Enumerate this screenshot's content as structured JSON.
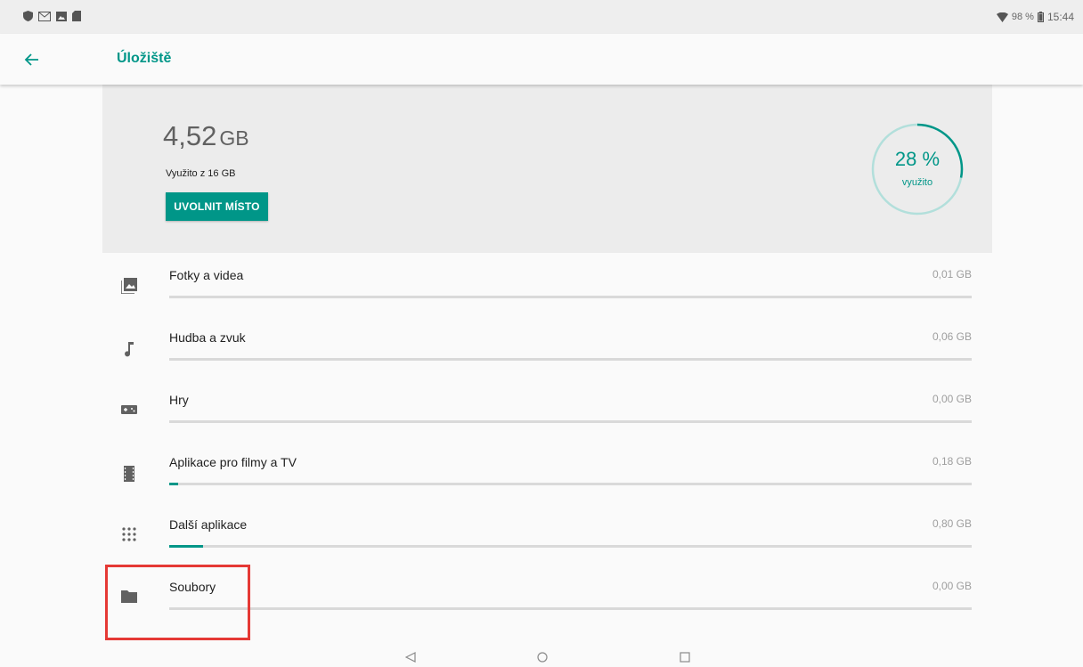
{
  "status_bar": {
    "left_icons": [
      "shield-icon",
      "gmail-icon",
      "photo-icon",
      "sd-card-icon"
    ],
    "battery_percent": "98 %",
    "time": "15:44"
  },
  "app_bar": {
    "back_icon": "arrow-back-icon",
    "title": "Úložiště"
  },
  "summary": {
    "used_value": "4,52",
    "used_unit": "GB",
    "used_of": "Využito z 16 GB",
    "free_button": "UVOLNIT MÍSTO",
    "percent_text": "28 %",
    "percent_label": "využito",
    "percent_value": 0.28
  },
  "categories": [
    {
      "label": "Fotky a videa",
      "size": "0,01 GB",
      "icon": "photo-library-icon",
      "fraction": 0.0
    },
    {
      "label": "Hudba a zvuk",
      "size": "0,06 GB",
      "icon": "music-note-icon",
      "fraction": 0.0
    },
    {
      "label": "Hry",
      "size": "0,00 GB",
      "icon": "gamepad-icon",
      "fraction": 0.0
    },
    {
      "label": "Aplikace pro filmy a TV",
      "size": "0,18 GB",
      "icon": "movie-icon",
      "fraction": 0.011
    },
    {
      "label": "Další aplikace",
      "size": "0,80 GB",
      "icon": "apps-grid-icon",
      "fraction": 0.042
    },
    {
      "label": "Soubory",
      "size": "0,00 GB",
      "icon": "folder-icon",
      "fraction": 0.0
    }
  ],
  "colors": {
    "accent": "#009688",
    "highlight": "#e53935"
  },
  "nav_bar": {
    "back": "nav-back-icon",
    "home": "nav-home-icon",
    "recents": "nav-recents-icon"
  }
}
